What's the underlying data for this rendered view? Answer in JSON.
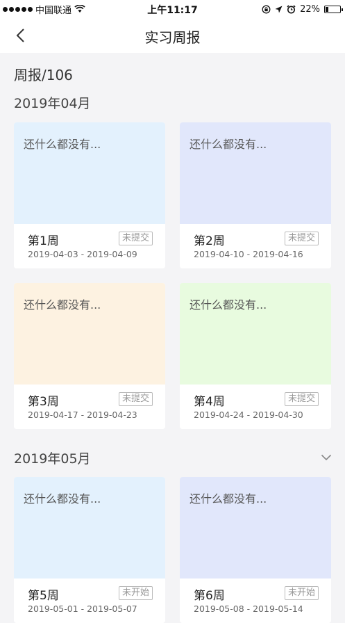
{
  "status_bar": {
    "carrier": "中国联通",
    "time": "上午11:17",
    "battery": "22%",
    "battery_level": 0.22
  },
  "nav": {
    "title": "实习周报"
  },
  "page": {
    "title": "周报/106"
  },
  "months": [
    {
      "label": "2019年04月",
      "weeks": [
        {
          "week": "第1周",
          "status": "未提交",
          "range": "2019-04-03 - 2019-04-09",
          "empty_text": "还什么都没有...",
          "color": "#e3f1fd"
        },
        {
          "week": "第2周",
          "status": "未提交",
          "range": "2019-04-10 - 2019-04-16",
          "empty_text": "还什么都没有...",
          "color": "#e1e7fb"
        },
        {
          "week": "第3周",
          "status": "未提交",
          "range": "2019-04-17 - 2019-04-23",
          "empty_text": "还什么都没有...",
          "color": "#fdf2e1"
        },
        {
          "week": "第4周",
          "status": "未提交",
          "range": "2019-04-24 - 2019-04-30",
          "empty_text": "还什么都没有...",
          "color": "#e8fbdf"
        }
      ]
    },
    {
      "label": "2019年05月",
      "weeks": [
        {
          "week": "第5周",
          "status": "未开始",
          "range": "2019-05-01 - 2019-05-07",
          "empty_text": "还什么都没有...",
          "color": "#e3f1fd"
        },
        {
          "week": "第6周",
          "status": "未开始",
          "range": "2019-05-08 - 2019-05-14",
          "empty_text": "还什么都没有...",
          "color": "#e1e7fb"
        }
      ]
    }
  ]
}
